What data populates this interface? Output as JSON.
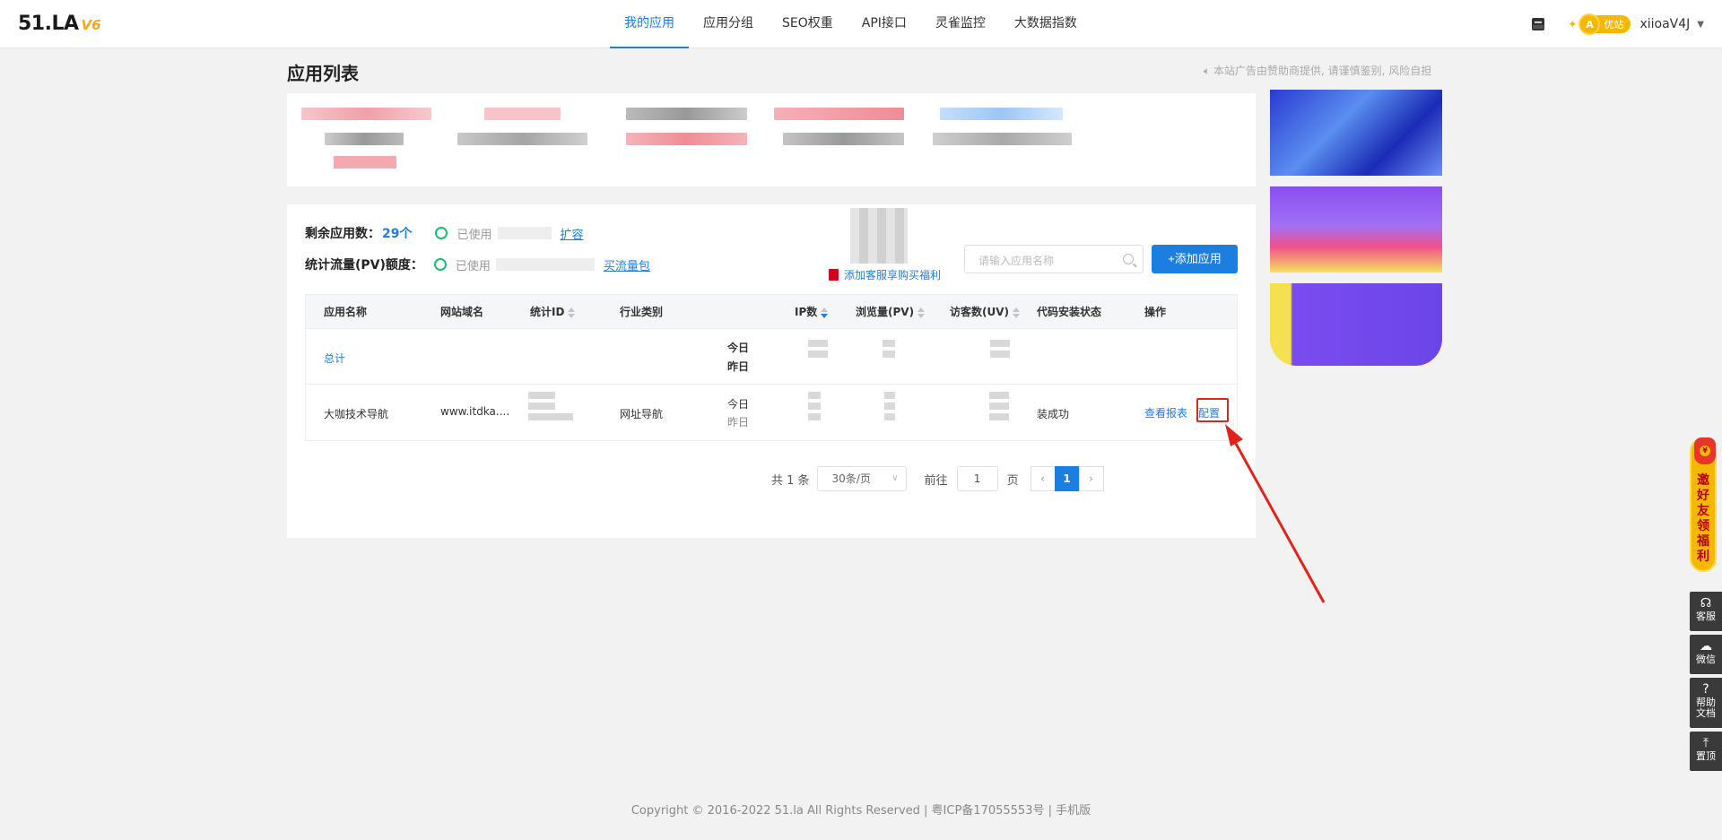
{
  "header": {
    "logo_main": "51.LA",
    "logo_version": "V6",
    "nav": [
      {
        "label": "我的应用",
        "active": true
      },
      {
        "label": "应用分组",
        "active": false
      },
      {
        "label": "SEO权重",
        "active": false
      },
      {
        "label": "API接口",
        "active": false
      },
      {
        "label": "灵雀监控",
        "active": false
      },
      {
        "label": "大数据指数",
        "active": false
      }
    ],
    "vip_badge": "优站",
    "username": "xiioaV4J"
  },
  "page": {
    "title": "应用列表",
    "ad_notice": "本站广告由赞助商提供, 请谨慎鉴别, 风险自担"
  },
  "quota": {
    "remaining_label": "剩余应用数：",
    "remaining_value": "29个",
    "used_label": "已使用",
    "expand_link": "扩容",
    "pv_label": "统计流量(PV)额度：",
    "pv_used_label": "已使用",
    "buy_link": "买流量包",
    "promo_text": "添加客服享购买福利"
  },
  "search": {
    "placeholder": "请输入应用名称"
  },
  "add_button": "+添加应用",
  "table": {
    "headers": [
      "应用名称",
      "网站域名",
      "统计ID",
      "行业类别",
      "IP数",
      "浏览量(PV)",
      "访客数(UV)",
      "代码安装状态",
      "操作"
    ],
    "total_row": {
      "name": "总计",
      "today": "今日",
      "yesterday": "昨日"
    },
    "rows": [
      {
        "name": "大咖技术导航",
        "domain": "www.itdka....",
        "category": "网址导航",
        "today": "今日",
        "yesterday": "昨日",
        "install_status": "装成功",
        "action_report": "查看报表",
        "action_config": "配置"
      }
    ]
  },
  "pagination": {
    "total": "共 1 条",
    "page_size": "30条/页",
    "goto_label": "前往",
    "goto_value": "1",
    "page_unit": "页",
    "current_page": "1"
  },
  "floating": {
    "invite": "邀好友领福利",
    "tools": [
      "客服",
      "微信",
      "帮助文档",
      "置顶"
    ]
  },
  "footer": {
    "text": "Copyright © 2016-2022 51.la All Rights Reserved | 粤ICP备17055553号 | 手机版"
  }
}
